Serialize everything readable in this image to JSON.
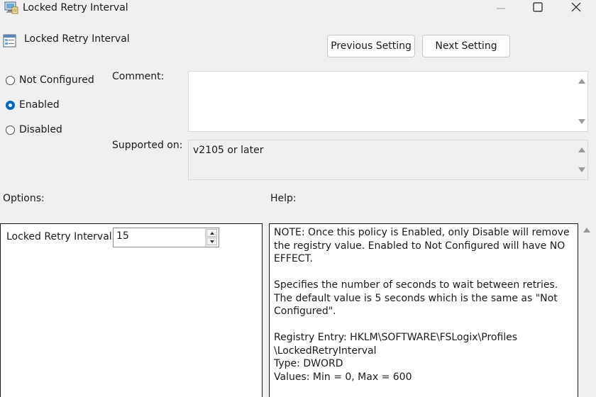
{
  "window": {
    "title": "Locked Retry Interval",
    "minimize_glyph": "—",
    "close_glyph": "✕"
  },
  "header": {
    "setting_title": "Locked Retry Interval",
    "previous_label": "Previous Setting",
    "next_label": "Next Setting"
  },
  "state": {
    "options": [
      "Not Configured",
      "Enabled",
      "Disabled"
    ],
    "selected": "Enabled"
  },
  "comment": {
    "label": "Comment:",
    "value": ""
  },
  "supported": {
    "label": "Supported on:",
    "value": "v2105 or later"
  },
  "options_section": {
    "label": "Options:",
    "field_label": "Locked Retry Interval",
    "field_value": "15"
  },
  "help_section": {
    "label": "Help:",
    "paragraphs": [
      "NOTE:  Once this policy is Enabled, only Disable will remove the registry value. Enabled to Not Configured will have NO EFFECT.",
      "Specifies the number of seconds to wait between retries. The default value is 5 seconds which is the same as \"Not Configured\"."
    ],
    "registry_lines": [
      "Registry Entry:  HKLM\\SOFTWARE\\FSLogix\\Profiles",
      "\\LockedRetryInterval",
      "Type:  DWORD",
      "Values:  Min = 0, Max = 600"
    ]
  },
  "colors": {
    "accent": "#0067c0",
    "window_bg": "#f0f0f0",
    "panel_bg": "#ffffff",
    "border": "#1a1a1a"
  }
}
